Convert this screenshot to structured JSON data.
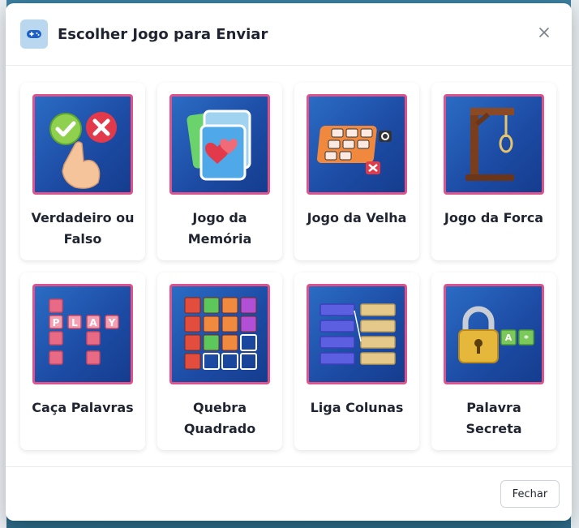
{
  "modal": {
    "title": "Escolher Jogo para Enviar",
    "close_icon": "close-icon",
    "header_icon": "gamepad-icon"
  },
  "games": [
    {
      "label": "Verdadeiro ou Falso",
      "icon": "true-false-icon"
    },
    {
      "label": "Jogo da Memória",
      "icon": "memory-cards-icon"
    },
    {
      "label": "Jogo da Velha",
      "icon": "tic-tac-toe-icon"
    },
    {
      "label": "Jogo da Forca",
      "icon": "gallows-icon"
    },
    {
      "label": "Caça Palavras",
      "icon": "word-search-icon",
      "tiles": "PLAY"
    },
    {
      "label": "Quebra Quadrado",
      "icon": "block-puzzle-icon"
    },
    {
      "label": "Liga Colunas",
      "icon": "match-columns-icon"
    },
    {
      "label": "Palavra Secreta",
      "icon": "padlock-icon",
      "tiles": "A*"
    }
  ],
  "footer": {
    "close_label": "Fechar"
  },
  "colors": {
    "card_border": "#e0528a",
    "card_bg": "#1f55b0",
    "header_icon_bg": "#b9d8f0"
  }
}
